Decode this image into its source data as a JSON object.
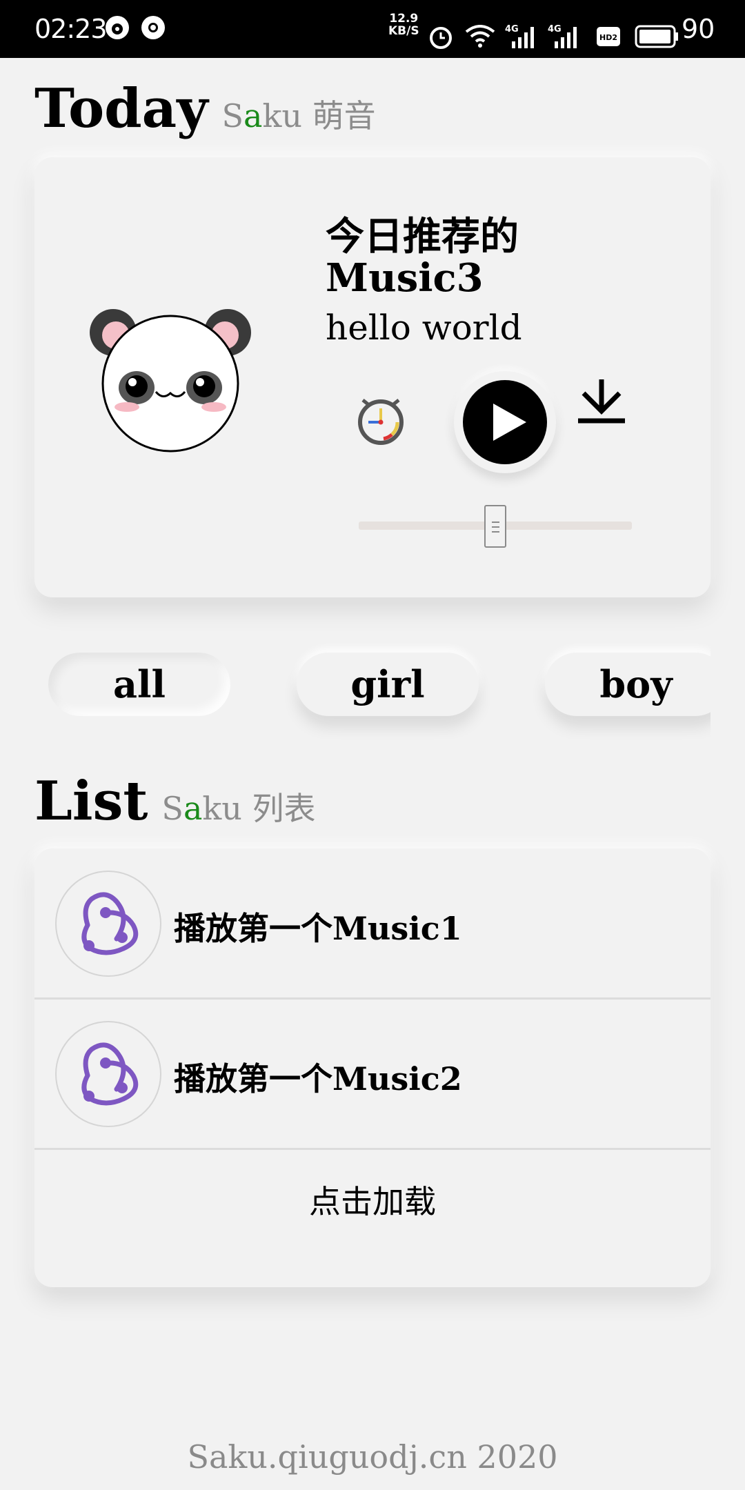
{
  "status_bar": {
    "time": "02:23",
    "net_speed_value": "12.9",
    "net_speed_unit": "KB/S",
    "signal_label": "4G",
    "hd_label": "HD2",
    "battery_level": "90"
  },
  "today": {
    "title": "Today",
    "subtitle_prefix": "S",
    "subtitle_accent": "a",
    "subtitle_rest": "ku 萌音",
    "recommend_line": "今日推荐的",
    "track_name": "Music3",
    "track_subtitle": "hello world",
    "volume_level": 0.5
  },
  "tabs": [
    {
      "label": "all",
      "active": true
    },
    {
      "label": "girl",
      "active": false
    },
    {
      "label": "boy",
      "active": false
    }
  ],
  "list": {
    "title": "List",
    "subtitle_prefix": "S",
    "subtitle_accent": "a",
    "subtitle_rest": "ku 列表",
    "items": [
      {
        "label": "播放第一个Music1"
      },
      {
        "label": "播放第一个Music2"
      }
    ],
    "load_more": "点击加载"
  },
  "footer": {
    "text": "Saku.qiuguodj.cn 2020"
  },
  "colors": {
    "accent_green": "#1a8a1a",
    "logo_purple": "#7e57c2",
    "background": "#f2f2f2"
  }
}
